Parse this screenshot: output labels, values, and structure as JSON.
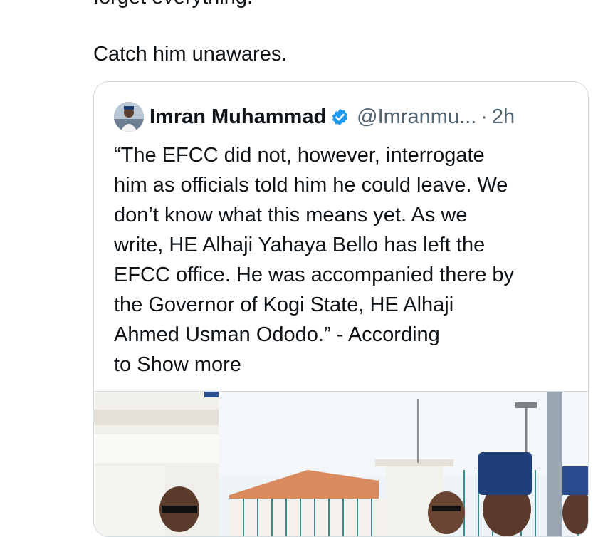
{
  "tweet": {
    "clipped_line": "forget everything.",
    "text": "Catch him unawares."
  },
  "quote": {
    "display_name": "Imran Muhammad",
    "handle": "@Imranmu...",
    "separator": "·",
    "time": "2h",
    "avatar_icon": "user-avatar-icon",
    "verified_icon": "verified-badge-icon",
    "verified_color": "#1d9bf0",
    "body_lines": [
      "“The EFCC did not, however, interrogate",
      "him as officials told him he could leave. We",
      "don’t know what this means yet. As we",
      "write, HE Alhaji Yahaya Bello has left the",
      "EFCC office. He was accompanied there by",
      "the Governor of Kogi State, HE Alhaji",
      "Ahmed Usman Ododo.” - According"
    ],
    "last_line_prefix": "to",
    "show_more": "Show more"
  },
  "colors": {
    "text": "#0f1419",
    "secondary": "#536471",
    "border": "#cfd9de"
  }
}
